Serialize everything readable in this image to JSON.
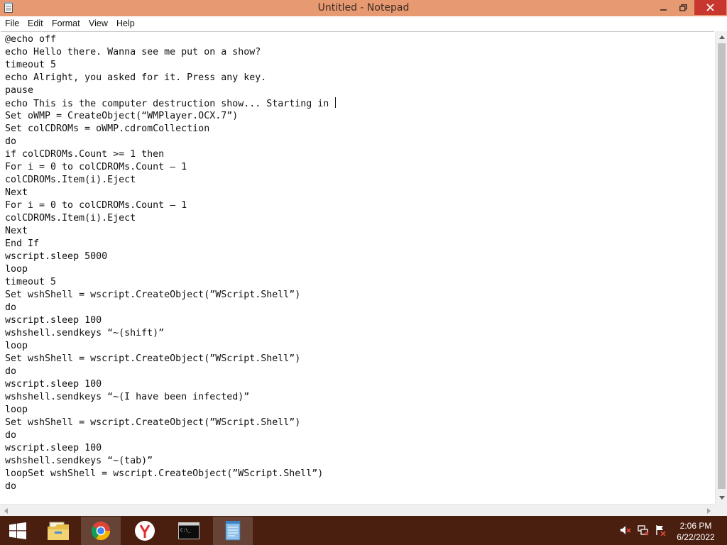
{
  "window": {
    "title": "Untitled - Notepad",
    "titlebar_color": "#e79a72"
  },
  "menu": [
    "File",
    "Edit",
    "Format",
    "View",
    "Help"
  ],
  "editor": {
    "lines": [
      "@echo off",
      "echo Hello there. Wanna see me put on a show?",
      "timeout 5",
      "echo Alright, you asked for it. Press any key.",
      "pause",
      "echo This is the computer destruction show... Starting in ",
      "Set oWMP = CreateObject(“WMPlayer.OCX.7”)",
      "Set colCDROMs = oWMP.cdromCollection",
      "do",
      "if colCDROMs.Count >= 1 then",
      "For i = 0 to colCDROMs.Count – 1",
      "colCDROMs.Item(i).Eject",
      "Next",
      "For i = 0 to colCDROMs.Count – 1",
      "colCDROMs.Item(i).Eject",
      "Next",
      "End If",
      "wscript.sleep 5000",
      "loop",
      "timeout 5",
      "Set wshShell = wscript.CreateObject(”WScript.Shell”)",
      "do",
      "wscript.sleep 100",
      "wshshell.sendkeys “~(shift)”",
      "loop",
      "Set wshShell = wscript.CreateObject(”WScript.Shell”)",
      "do",
      "wscript.sleep 100",
      "wshshell.sendkeys “~(I have been infected)”",
      "loop",
      "Set wshShell = wscript.CreateObject(”WScript.Shell”)",
      "do",
      "wscript.sleep 100",
      "wshshell.sendkeys “~(tab)”",
      "loopSet wshShell = wscript.CreateObject(”WScript.Shell”)",
      "do"
    ]
  },
  "taskbar": {
    "color": "#4a1f10",
    "apps": [
      {
        "name": "start",
        "icon": "windows-logo-icon",
        "active": false
      },
      {
        "name": "file-explorer",
        "icon": "folder-icon",
        "active": false
      },
      {
        "name": "chrome",
        "icon": "chrome-icon",
        "active": true
      },
      {
        "name": "yandex",
        "icon": "yandex-icon",
        "active": false
      },
      {
        "name": "command-prompt",
        "icon": "cmd-icon",
        "active": false
      },
      {
        "name": "notepad",
        "icon": "notepad-icon",
        "active": true
      }
    ],
    "tray": [
      "volume-muted-icon",
      "network-icon",
      "action-center-flag-icon"
    ],
    "clock": {
      "time": "2:06 PM",
      "date": "6/22/2022"
    }
  }
}
